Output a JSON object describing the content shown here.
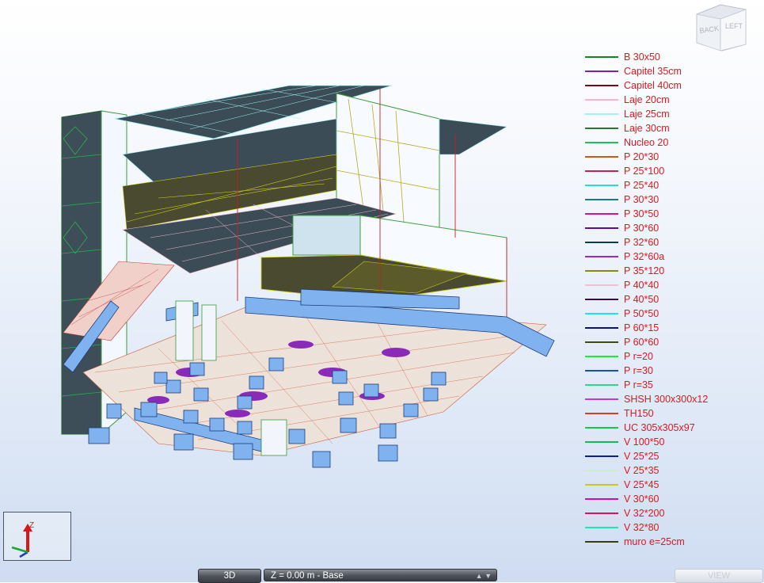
{
  "view_cube": {
    "back_label": "BACK",
    "left_label": "LEFT"
  },
  "legend": {
    "items": [
      {
        "label": "B 30x50",
        "color": "#0a8a1e"
      },
      {
        "label": "Capitel 35cm",
        "color": "#8a1ab0"
      },
      {
        "label": "Capitel 40cm",
        "color": "#7a0b14"
      },
      {
        "label": "Laje 20cm",
        "color": "#f5b8c6"
      },
      {
        "label": "Laje 25cm",
        "color": "#a0f0f8"
      },
      {
        "label": "Laje 30cm",
        "color": "#1e7e22"
      },
      {
        "label": "Nucleo 20",
        "color": "#19c25c"
      },
      {
        "label": "P 20*30",
        "color": "#c85a1a"
      },
      {
        "label": "P 25*100",
        "color": "#c81e50"
      },
      {
        "label": "P 25*40",
        "color": "#2cd8dc"
      },
      {
        "label": "P 30*30",
        "color": "#157c82"
      },
      {
        "label": "P 30*50",
        "color": "#e0108a"
      },
      {
        "label": "P 30*60",
        "color": "#5a0aa8"
      },
      {
        "label": "P 32*60",
        "color": "#0c3c44"
      },
      {
        "label": "P 32*60a",
        "color": "#9a28c8"
      },
      {
        "label": "P 35*120",
        "color": "#8a8a0a"
      },
      {
        "label": "P 40*40",
        "color": "#f2c2ca"
      },
      {
        "label": "P 40*50",
        "color": "#3a0a4a"
      },
      {
        "label": "P 50*50",
        "color": "#1ae8d8"
      },
      {
        "label": "P 60*15",
        "color": "#0a1478"
      },
      {
        "label": "P 60*60",
        "color": "#3e4a14"
      },
      {
        "label": "P r=20",
        "color": "#22e832"
      },
      {
        "label": "P r=30",
        "color": "#1450b4"
      },
      {
        "label": "P r=35",
        "color": "#24dc8c"
      },
      {
        "label": "SHSH 300x300x12",
        "color": "#c038d8"
      },
      {
        "label": "TH150",
        "color": "#c84818"
      },
      {
        "label": "UC 305x305x97",
        "color": "#14c848"
      },
      {
        "label": "V 100*50",
        "color": "#0ac056"
      },
      {
        "label": "V 25*25",
        "color": "#0a1e9e"
      },
      {
        "label": "V 25*35",
        "color": "#c8f0cc"
      },
      {
        "label": "V 25*45",
        "color": "#c8c81e"
      },
      {
        "label": "V 30*60",
        "color": "#d80aa8"
      },
      {
        "label": "V 32*200",
        "color": "#e0105a"
      },
      {
        "label": "V 32*80",
        "color": "#1ee8b0"
      },
      {
        "label": "muro e=25cm",
        "color": "#3c3c14"
      }
    ]
  },
  "axis": {
    "z_label": "Z"
  },
  "status_bar": {
    "mode": "3D",
    "plane": "Z = 0.00 m - Base",
    "plane_arrows": "▲ ▼",
    "view": "VIEW"
  },
  "colors": {
    "accent_label": "#e8141d",
    "slab_fill": "#3c4c56",
    "wall_fill": "#f8fbff",
    "foundation_blue": "#7fb2ef"
  }
}
